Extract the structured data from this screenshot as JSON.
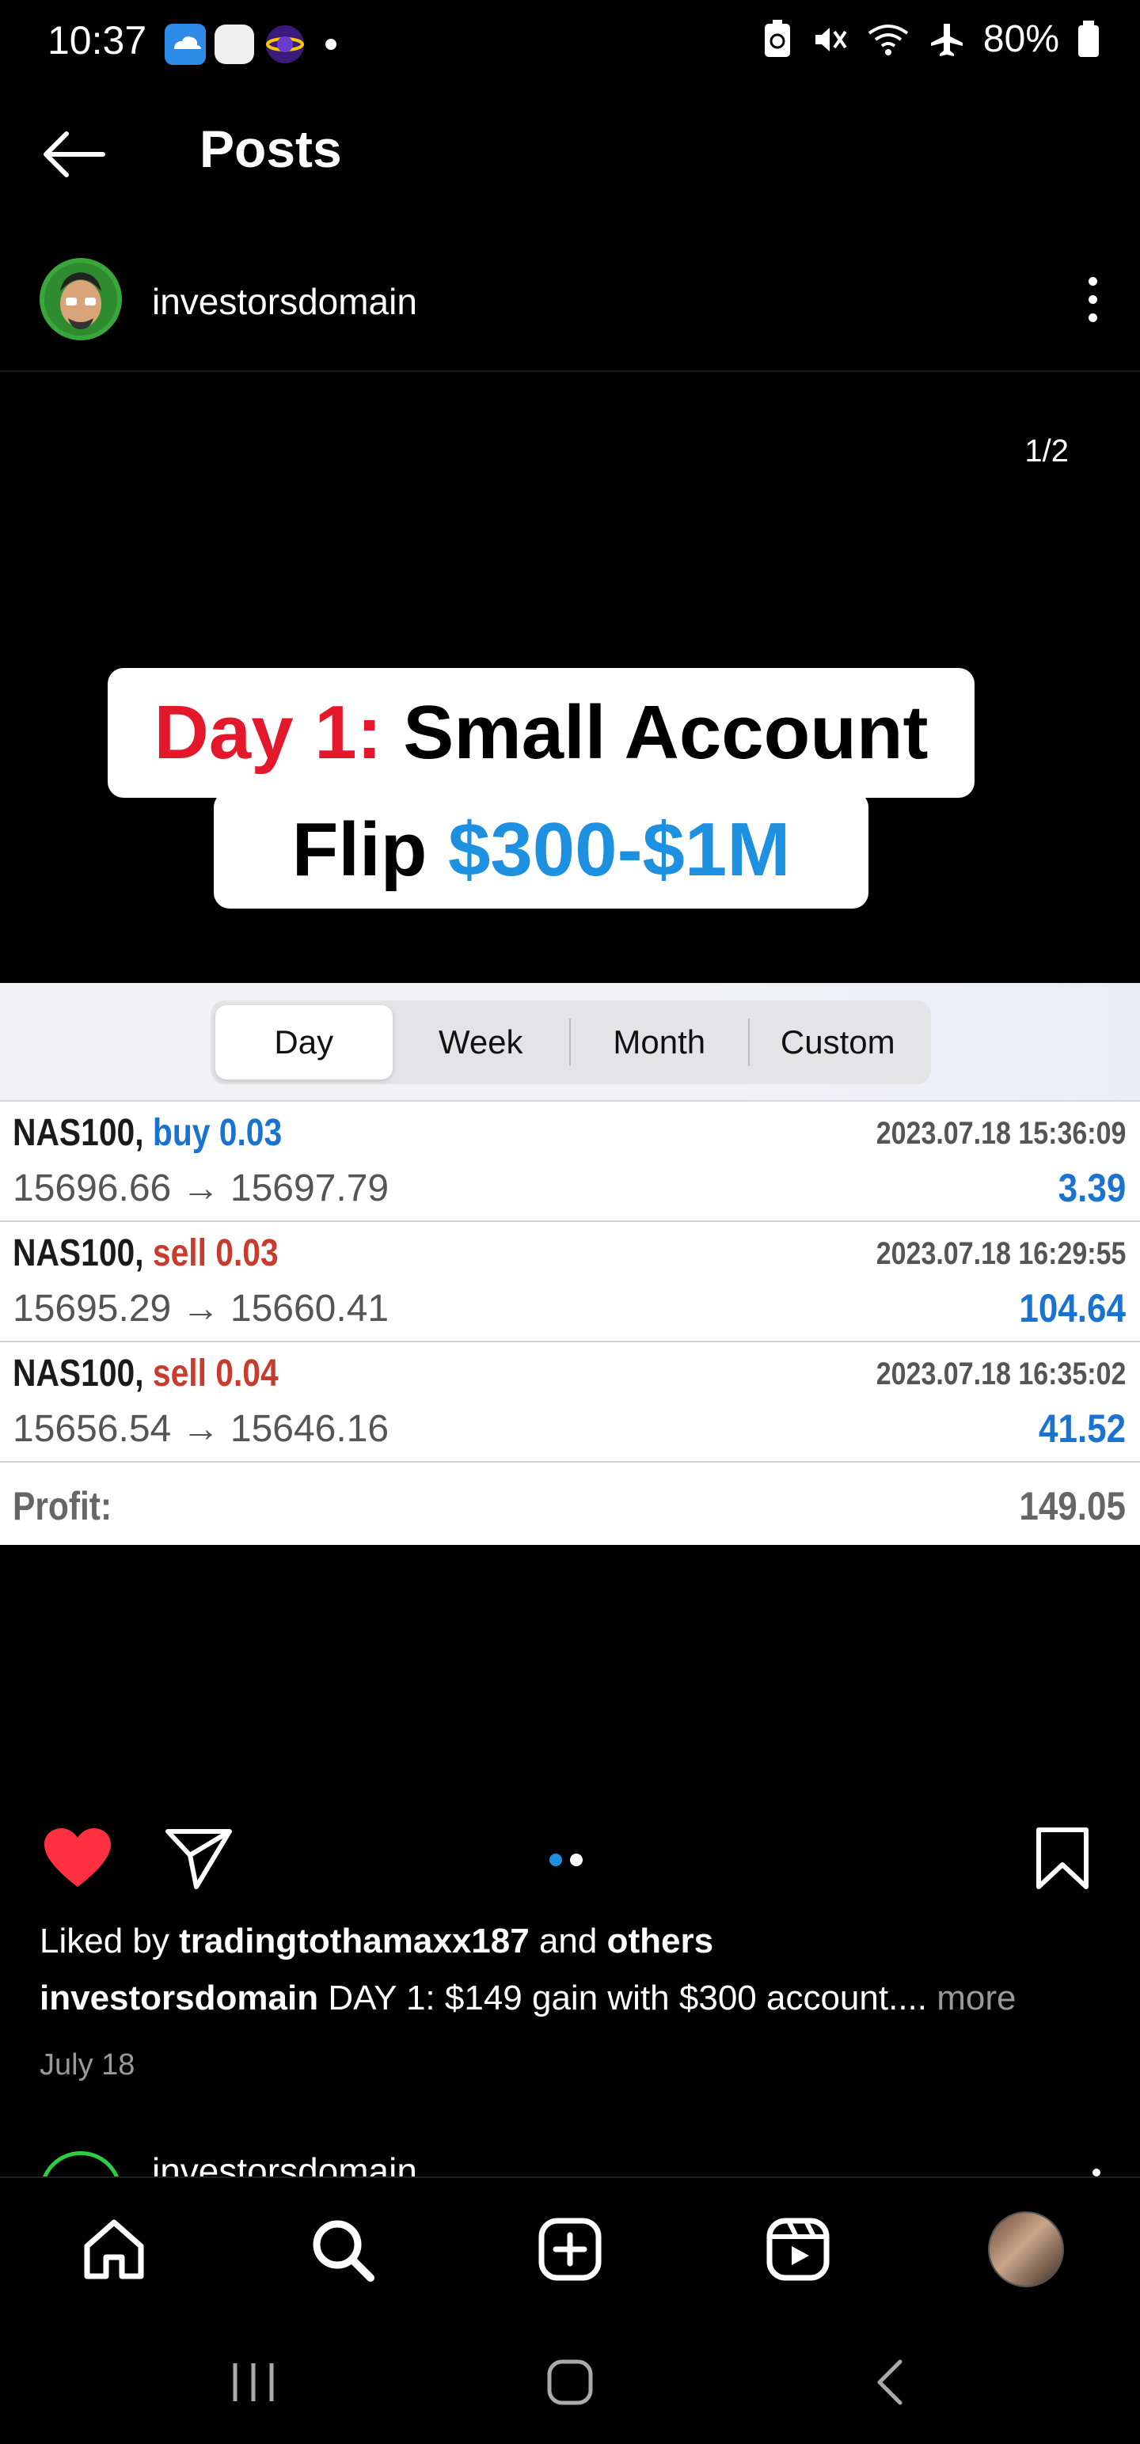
{
  "status_bar": {
    "time": "10:37",
    "battery": "80%"
  },
  "header": {
    "title": "Posts"
  },
  "post": {
    "username": "investorsdomain",
    "media_counter": "1/2",
    "banner": {
      "line1_red": "Day 1:",
      "line1_black": "Small Account",
      "line2_black": "Flip",
      "line2_blue": "$300-$1M"
    },
    "tabs": [
      "Day",
      "Week",
      "Month",
      "Custom"
    ],
    "active_tab": "Day",
    "trades": [
      {
        "symbol": "NAS100,",
        "side": "buy 0.03",
        "side_type": "buy",
        "prices": "15696.66 → 15697.79",
        "time": "2023.07.18 15:36:09",
        "profit": "3.39"
      },
      {
        "symbol": "NAS100,",
        "side": "sell 0.03",
        "side_type": "sell",
        "prices": "15695.29 → 15660.41",
        "time": "2023.07.18 16:29:55",
        "profit": "104.64"
      },
      {
        "symbol": "NAS100,",
        "side": "sell 0.04",
        "side_type": "sell",
        "prices": "15656.54 → 15646.16",
        "time": "2023.07.18 16:35:02",
        "profit": "41.52"
      }
    ],
    "profit_label": "Profit:",
    "profit_total": "149.05",
    "likes": {
      "prefix": "Liked by",
      "user": "tradingtothamaxx187",
      "middle": "and",
      "others": "others"
    },
    "caption": {
      "user": "investorsdomain",
      "text": "DAY 1: $149 gain with $300 account....",
      "more": "more"
    },
    "date": "July 18"
  },
  "next_post": {
    "username": "investorsdomain"
  },
  "colors": {
    "like_red": "#ff3040",
    "accent_blue": "#1e90e0",
    "buy_blue": "#1a73d0",
    "sell_red": "#c83c2e"
  }
}
